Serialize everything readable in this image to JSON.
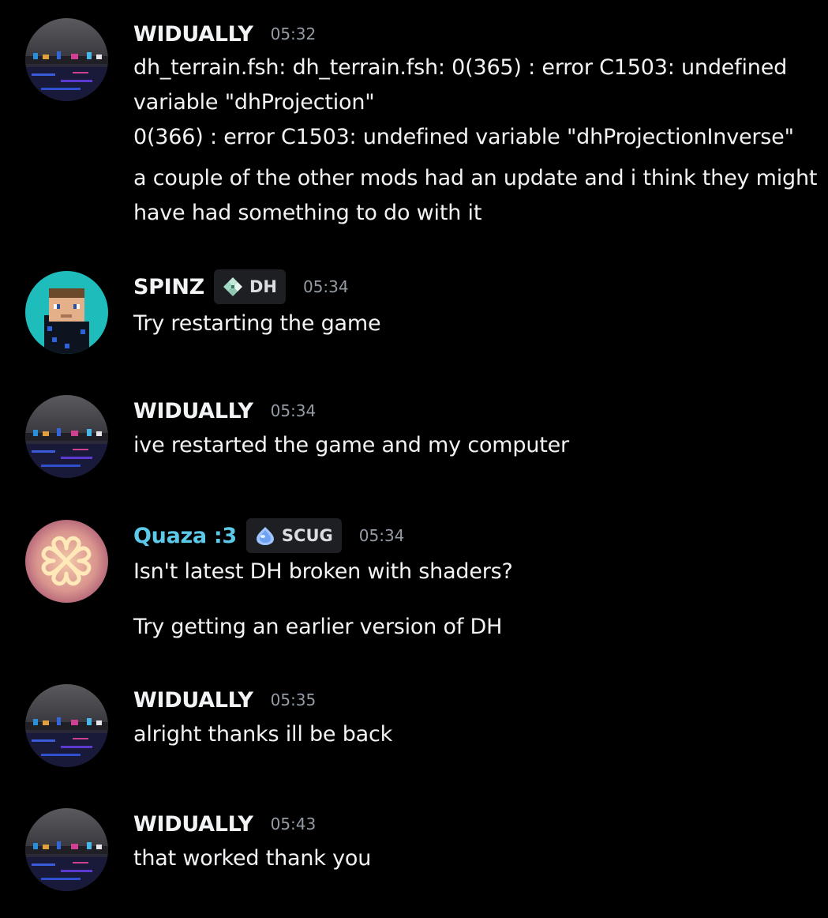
{
  "messages": [
    {
      "username": "WIDUALLY",
      "avatar": "city-night-avatar",
      "timestamp": "05:32",
      "lines": [
        "dh_terrain.fsh: dh_terrain.fsh: 0(365) : error C1503: undefined",
        "variable \"dhProjection\"",
        "0(366) : error C1503: undefined variable \"dhProjectionInverse\"",
        "a couple of the other mods had an update and i think they might",
        "have had something to do with it"
      ]
    },
    {
      "username": "SPINZ",
      "avatar": "minecraft-skin-avatar",
      "badge": {
        "icon": "diamond-shield-icon",
        "label": "DH"
      },
      "timestamp": "05:34",
      "lines": [
        "Try restarting the game"
      ]
    },
    {
      "username": "WIDUALLY",
      "avatar": "city-night-avatar",
      "timestamp": "05:34",
      "lines": [
        "ive restarted the game and my computer"
      ]
    },
    {
      "username": "Quaza :3",
      "username_color": "#5cc9e8",
      "avatar": "neon-hearts-avatar",
      "badge": {
        "icon": "blue-gem-icon",
        "label": "SCUG"
      },
      "timestamp": "05:34",
      "lines": [
        "Isn't latest DH broken with shaders?",
        "Try getting an earlier version of DH"
      ]
    },
    {
      "username": "WIDUALLY",
      "avatar": "city-night-avatar",
      "timestamp": "05:35",
      "lines": [
        "alright thanks ill be back"
      ]
    },
    {
      "username": "WIDUALLY",
      "avatar": "city-night-avatar",
      "timestamp": "05:43",
      "lines": [
        "that worked thank you"
      ]
    }
  ],
  "colors": {
    "background": "#000000",
    "username": "#f2f3f5",
    "username_teal": "#5cc9e8",
    "timestamp": "#949ba4",
    "badge_bg": "#1e1f22"
  }
}
